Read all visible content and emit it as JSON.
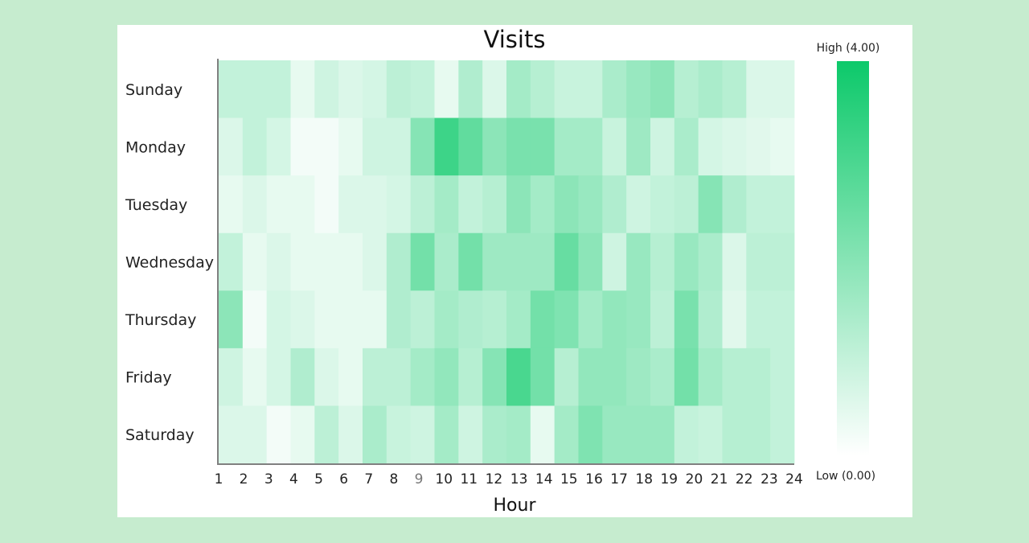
{
  "chart_data": {
    "type": "heatmap",
    "title": "Visits",
    "xlabel": "Hour",
    "ylabel": "",
    "x": [
      "1",
      "2",
      "3",
      "4",
      "5",
      "6",
      "7",
      "8",
      "9",
      "10",
      "11",
      "12",
      "13",
      "14",
      "15",
      "16",
      "17",
      "18",
      "19",
      "20",
      "21",
      "22",
      "23",
      "24"
    ],
    "y": [
      "Sunday",
      "Monday",
      "Tuesday",
      "Wednesday",
      "Thursday",
      "Friday",
      "Saturday"
    ],
    "values": [
      [
        1.0,
        1.0,
        1.0,
        0.4,
        0.8,
        0.6,
        0.7,
        1.1,
        1.0,
        0.4,
        1.3,
        0.6,
        1.5,
        1.2,
        0.9,
        0.9,
        1.4,
        1.7,
        1.9,
        1.2,
        1.4,
        1.2,
        0.6,
        0.6
      ],
      [
        0.6,
        1.0,
        0.7,
        0.2,
        0.2,
        0.4,
        0.8,
        0.8,
        2.0,
        3.2,
        2.6,
        1.9,
        2.2,
        2.2,
        1.5,
        1.5,
        0.9,
        1.6,
        0.8,
        1.4,
        0.7,
        0.6,
        0.5,
        0.4
      ],
      [
        0.4,
        0.6,
        0.4,
        0.4,
        0.2,
        0.6,
        0.6,
        0.7,
        1.1,
        1.5,
        1.0,
        1.2,
        1.9,
        1.5,
        1.9,
        1.7,
        1.3,
        0.8,
        1.0,
        1.1,
        2.0,
        1.3,
        1.0,
        1.0
      ],
      [
        1.0,
        0.4,
        0.6,
        0.4,
        0.4,
        0.4,
        0.6,
        1.3,
        2.3,
        1.4,
        2.3,
        1.6,
        1.6,
        1.6,
        2.5,
        1.9,
        0.8,
        1.7,
        1.2,
        1.7,
        1.4,
        0.6,
        1.1,
        1.1
      ],
      [
        1.9,
        0.2,
        0.7,
        0.6,
        0.4,
        0.4,
        0.4,
        1.3,
        1.1,
        1.5,
        1.3,
        1.2,
        1.5,
        2.3,
        2.1,
        1.5,
        1.8,
        1.7,
        1.1,
        2.2,
        1.3,
        0.5,
        1.0,
        1.0
      ],
      [
        0.8,
        0.4,
        0.7,
        1.3,
        0.6,
        0.4,
        1.1,
        1.1,
        1.5,
        1.8,
        1.2,
        2.0,
        3.0,
        2.3,
        1.2,
        1.8,
        1.8,
        1.6,
        1.4,
        2.3,
        1.5,
        1.2,
        1.2,
        1.0
      ],
      [
        0.6,
        0.6,
        0.2,
        0.4,
        1.1,
        0.6,
        1.4,
        0.9,
        0.8,
        1.5,
        0.8,
        1.4,
        1.5,
        0.4,
        1.5,
        2.1,
        1.7,
        1.7,
        1.7,
        1.0,
        0.9,
        1.2,
        1.2,
        1.0
      ]
    ],
    "scale": {
      "min": 0.0,
      "max": 4.0,
      "low_color": "#ffffff",
      "high_color": "#0cc96a",
      "high_label": "High (4.00)",
      "low_label": "Low (0.00)"
    },
    "highlighted_tick": "9",
    "legend": "right"
  },
  "colors": {
    "page_background": "#c6eccf",
    "card_background": "#ffffff",
    "axis_line": "#808080"
  }
}
